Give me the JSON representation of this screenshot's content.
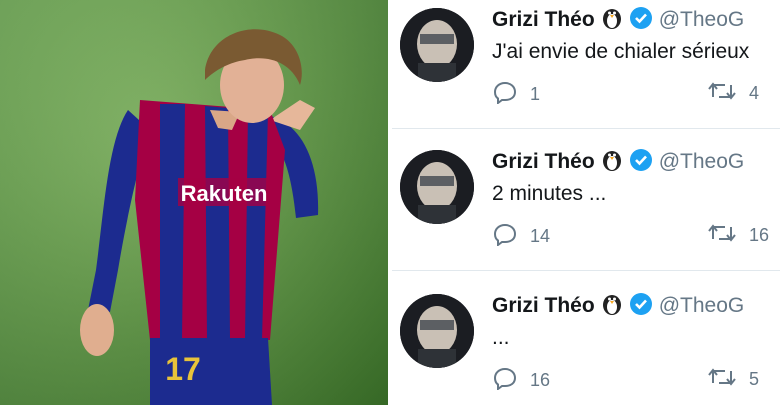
{
  "tweets": [
    {
      "name": "Grizi Théo",
      "handle": "@TheoG",
      "text": "J'ai envie de chialer sérieux",
      "replies": "1",
      "retweets": "4"
    },
    {
      "name": "Grizi Théo",
      "handle": "@TheoG",
      "text": "2 minutes ...",
      "replies": "14",
      "retweets": "16"
    },
    {
      "name": "Grizi Théo",
      "handle": "@TheoG",
      "text": "...",
      "replies": "16",
      "retweets": "5"
    }
  ],
  "photo": {
    "sponsor": "Rakuten",
    "number": "17"
  },
  "colors": {
    "verified": "#1da1f2",
    "muted": "#657786",
    "text": "#14171a",
    "barcaRed": "#a50044",
    "barcaBlue": "#1c2b8f"
  },
  "icons": [
    "penguin-emoji-icon",
    "verified-badge-icon",
    "reply-icon",
    "retweet-icon"
  ]
}
